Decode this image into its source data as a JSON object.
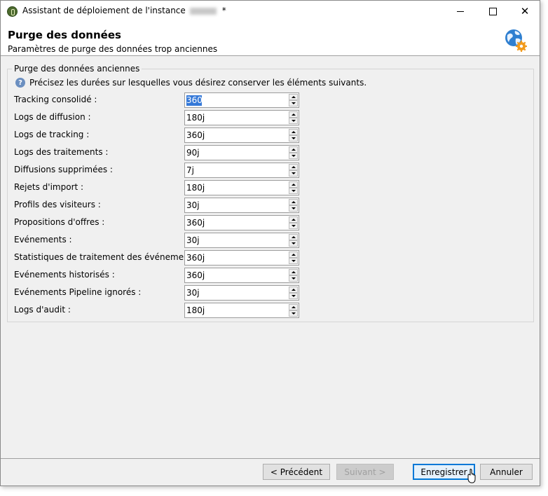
{
  "window": {
    "title": "Assistant de déploiement de l'instance",
    "title_suffix": "*"
  },
  "header": {
    "title": "Purge des données",
    "subtitle": "Paramètres de purge des données trop anciennes",
    "icon": "globe-gear-icon"
  },
  "group": {
    "legend": "Purge des données anciennes",
    "hint": "Précisez les durées sur lesquelles vous désirez conserver les éléments suivants."
  },
  "fields": [
    {
      "label": "Tracking consolidé :",
      "value": "360j"
    },
    {
      "label": "Logs de diffusion :",
      "value": "180j"
    },
    {
      "label": "Logs de tracking :",
      "value": "360j"
    },
    {
      "label": "Logs des traitements :",
      "value": "90j"
    },
    {
      "label": "Diffusions supprimées :",
      "value": "7j"
    },
    {
      "label": "Rejets d'import :",
      "value": "180j"
    },
    {
      "label": "Profils des visiteurs :",
      "value": "30j"
    },
    {
      "label": "Propositions d'offres :",
      "value": "360j"
    },
    {
      "label": "Evénements :",
      "value": "30j"
    },
    {
      "label": "Statistiques de traitement des événements :",
      "value": "360j"
    },
    {
      "label": "Evénements historisés :",
      "value": "360j"
    },
    {
      "label": "Evénements Pipeline ignorés :",
      "value": "30j"
    },
    {
      "label": "Logs d'audit :",
      "value": "180j"
    }
  ],
  "buttons": {
    "previous": "< Précédent",
    "next": "Suivant >",
    "save": "Enregistrer",
    "cancel": "Annuler"
  },
  "colors": {
    "accent": "#0078d7",
    "selection": "#3579d8"
  }
}
